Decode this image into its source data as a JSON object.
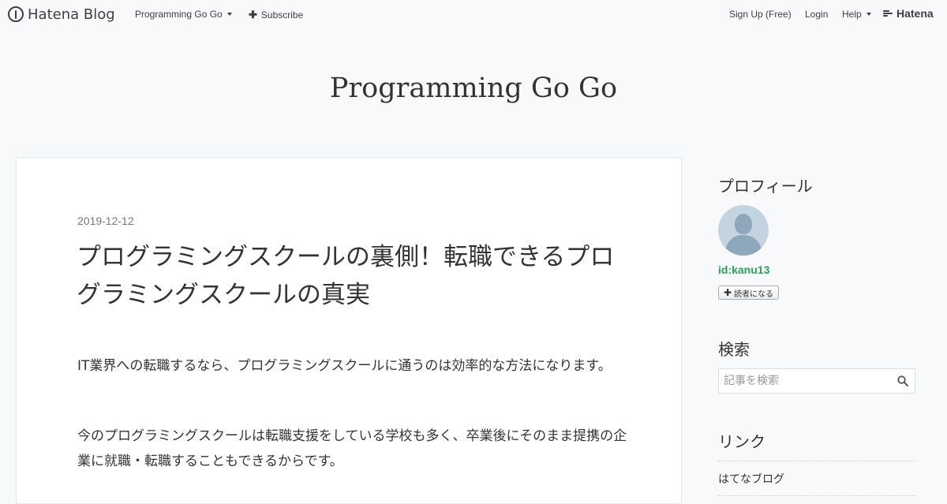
{
  "global_header": {
    "logo_text": "Hatena Blog",
    "blog_menu_label": "Programming Go Go",
    "subscribe_label": "Subscribe",
    "signup_label": "Sign Up (Free)",
    "login_label": "Login",
    "help_label": "Help",
    "hatena_label": "Hatena"
  },
  "blog": {
    "title": "Programming Go Go"
  },
  "entry": {
    "date": "2019-12-12",
    "title": "プログラミングスクールの裏側！転職できるプログラミングスクールの真実",
    "paragraphs": [
      "IT業界への転職するなら、プログラミングスクールに通うのは効率的な方法になります。",
      "今のプログラミングスクールは転職支援をしている学校も多く、卒業後にそのまま提携の企業に就職・転職することもできるからです。"
    ]
  },
  "sidebar": {
    "profile_heading": "プロフィール",
    "profile_id": "id:kanu13",
    "subscribe_button": "読者になる",
    "search_heading": "検索",
    "search_placeholder": "記事を検索",
    "links_heading": "リンク",
    "links": [
      "はてなブログ"
    ]
  },
  "colors": {
    "background": "#f8f9fa",
    "card": "#ffffff",
    "text": "#333333",
    "id_link": "#25a35a",
    "date": "#777777"
  }
}
